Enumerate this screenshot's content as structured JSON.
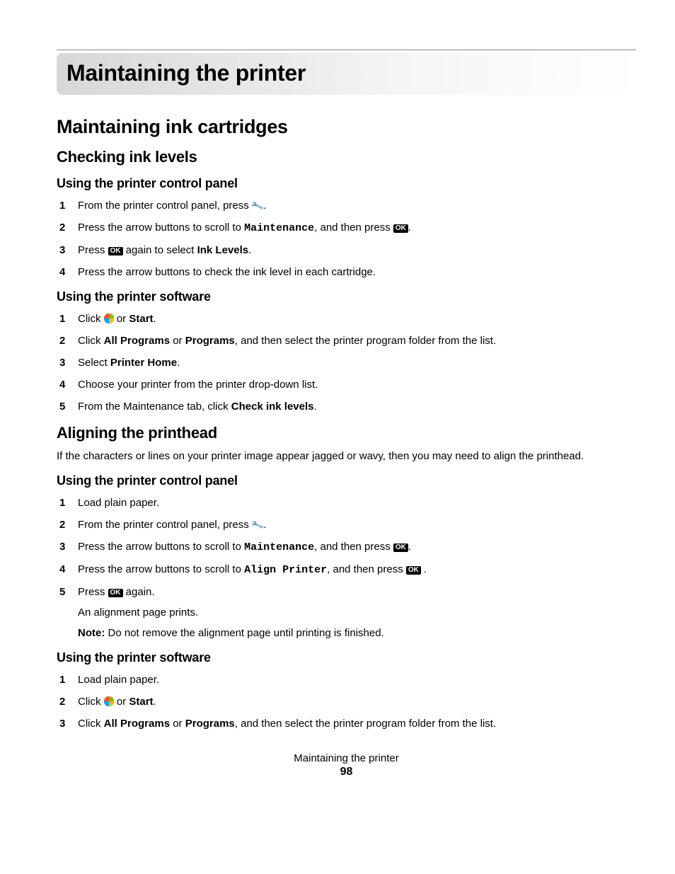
{
  "title": "Maintaining the printer",
  "h2_1": "Maintaining ink cartridges",
  "h3_1": "Checking ink levels",
  "h4_1": "Using the printer control panel",
  "s1": {
    "step1_a": "From the printer control panel, press ",
    "step1_b": ".",
    "step2_a": "Press the arrow buttons to scroll to ",
    "step2_mono": "Maintenance",
    "step2_b": ", and then press ",
    "step2_c": ".",
    "step3_a": "Press ",
    "step3_b": " again to select ",
    "step3_bold": "Ink Levels",
    "step3_c": ".",
    "step4": "Press the arrow buttons to check the ink level in each cartridge."
  },
  "h4_2": "Using the printer software",
  "s2": {
    "step1_a": "Click ",
    "step1_b": " or ",
    "step1_bold": "Start",
    "step1_c": ".",
    "step2_a": "Click ",
    "step2_bold1": "All Programs",
    "step2_b": " or ",
    "step2_bold2": "Programs",
    "step2_c": ", and then select the printer program folder from the list.",
    "step3_a": "Select ",
    "step3_bold": "Printer Home",
    "step3_b": ".",
    "step4": "Choose your printer from the printer drop-down list.",
    "step5_a": "From the Maintenance tab, click ",
    "step5_bold": "Check ink levels",
    "step5_b": "."
  },
  "h3_2": "Aligning the printhead",
  "p1": "If the characters or lines on your printer image appear jagged or wavy, then you may need to align the printhead.",
  "h4_3": "Using the printer control panel",
  "s3": {
    "step1": "Load plain paper.",
    "step2_a": "From the printer control panel, press ",
    "step2_b": ".",
    "step3_a": "Press the arrow buttons to scroll to ",
    "step3_mono": "Maintenance",
    "step3_b": ", and then press ",
    "step3_c": ".",
    "step4_a": "Press the arrow buttons to scroll to ",
    "step4_mono": "Align Printer",
    "step4_b": ", and then press ",
    "step4_c": " .",
    "step5_a": "Press ",
    "step5_b": " again.",
    "step5_sub": "An alignment page prints.",
    "step5_note_label": "Note:",
    "step5_note": " Do not remove the alignment page until printing is finished."
  },
  "h4_4": "Using the printer software",
  "s4": {
    "step1": "Load plain paper.",
    "step2_a": "Click ",
    "step2_b": " or ",
    "step2_bold": "Start",
    "step2_c": ".",
    "step3_a": "Click ",
    "step3_bold1": "All Programs",
    "step3_b": " or ",
    "step3_bold2": "Programs",
    "step3_c": ", and then select the printer program folder from the list."
  },
  "ok_label": "OK",
  "footer_title": "Maintaining the printer",
  "footer_page": "98"
}
